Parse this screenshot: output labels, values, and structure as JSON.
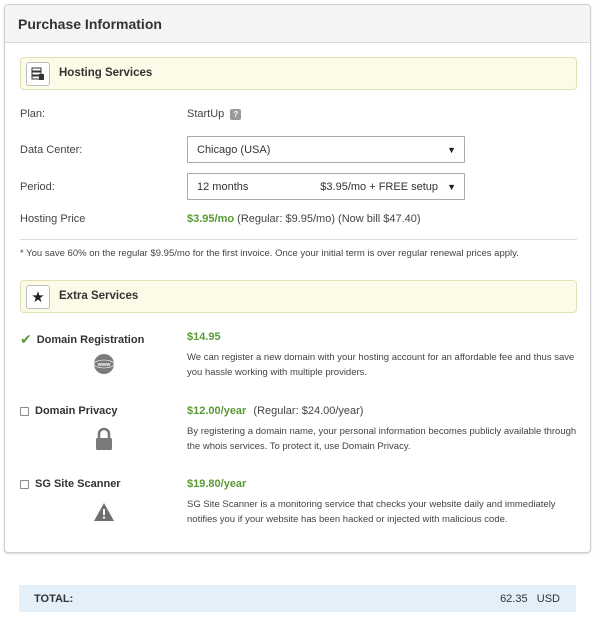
{
  "card": {
    "title": "Purchase Information"
  },
  "hosting": {
    "title": "Hosting Services",
    "plan_label": "Plan:",
    "plan_value": "StartUp",
    "data_center_label": "Data Center:",
    "data_center_value": "Chicago (USA)",
    "period_label": "Period:",
    "period_value": "12 months",
    "period_price": "$3.95/mo + FREE setup",
    "hosting_price_label": "Hosting Price",
    "hosting_price": "$3.95/mo",
    "hosting_price_detail": "(Regular: $9.95/mo) (Now bill $47.40)",
    "note": "* You save 60% on the regular $9.95/mo for the first invoice. Once your initial term is over regular renewal prices apply."
  },
  "extras": {
    "title": "Extra Services",
    "items": [
      {
        "name": "Domain Registration",
        "price": "$14.95",
        "regular": "",
        "description": "We can register a new domain with your hosting account for an affordable fee and thus save you hassle working with multiple providers.",
        "checked": true,
        "icon_text": "www"
      },
      {
        "name": "Domain Privacy",
        "price": "$12.00/year",
        "regular": "(Regular: $24.00/year)",
        "description": "By registering a domain name, your personal information becomes publicly available through the whois services. To protect it, use Domain Privacy.",
        "checked": false
      },
      {
        "name": "SG Site Scanner",
        "price": "$19.80/year",
        "regular": "",
        "description": "SG Site Scanner is a monitoring service that checks your website daily and immediately notifies you if your website has been hacked or injected with malicious code.",
        "checked": false
      }
    ]
  },
  "total": {
    "label": "TOTAL:",
    "amount": "62.35",
    "currency": "USD"
  },
  "colors": {
    "price_green": "#5a9a36",
    "section_bg": "#fcfbe8",
    "total_bg": "#e3f0fa"
  }
}
